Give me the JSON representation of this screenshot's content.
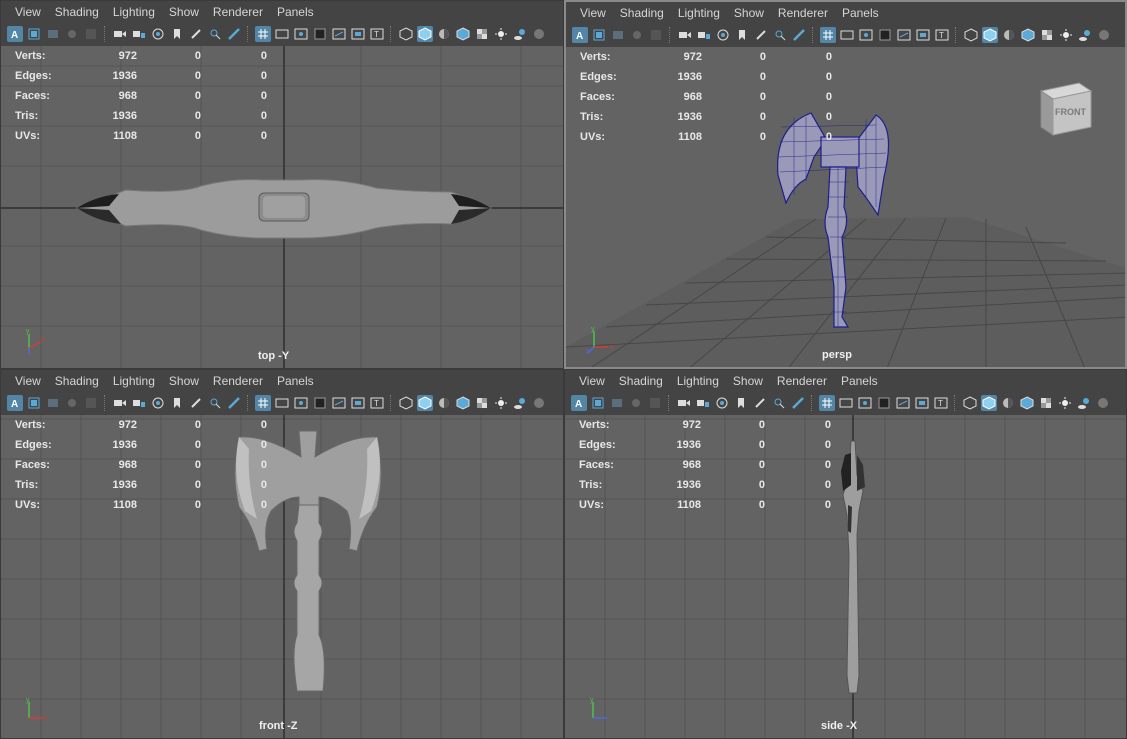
{
  "menu": [
    "View",
    "Shading",
    "Lighting",
    "Show",
    "Renderer",
    "Panels"
  ],
  "hud": {
    "rows": [
      {
        "label": "Verts:",
        "v1": "972",
        "v2": "0",
        "v3": "0"
      },
      {
        "label": "Edges:",
        "v1": "1936",
        "v2": "0",
        "v3": "0"
      },
      {
        "label": "Faces:",
        "v1": "968",
        "v2": "0",
        "v3": "0"
      },
      {
        "label": "Tris:",
        "v1": "1936",
        "v2": "0",
        "v3": "0"
      },
      {
        "label": "UVs:",
        "v1": "1108",
        "v2": "0",
        "v3": "0"
      }
    ]
  },
  "panels": [
    {
      "camera": "top -Y"
    },
    {
      "camera": "persp",
      "viewcube": "FRONT"
    },
    {
      "camera": "front -Z"
    },
    {
      "camera": "side -X"
    }
  ],
  "axis": {
    "y": "y",
    "x": "x",
    "z": "z"
  },
  "colors": {
    "accent": "#5285a6",
    "wire": "#1e1e8c",
    "viewport": "#636363"
  }
}
